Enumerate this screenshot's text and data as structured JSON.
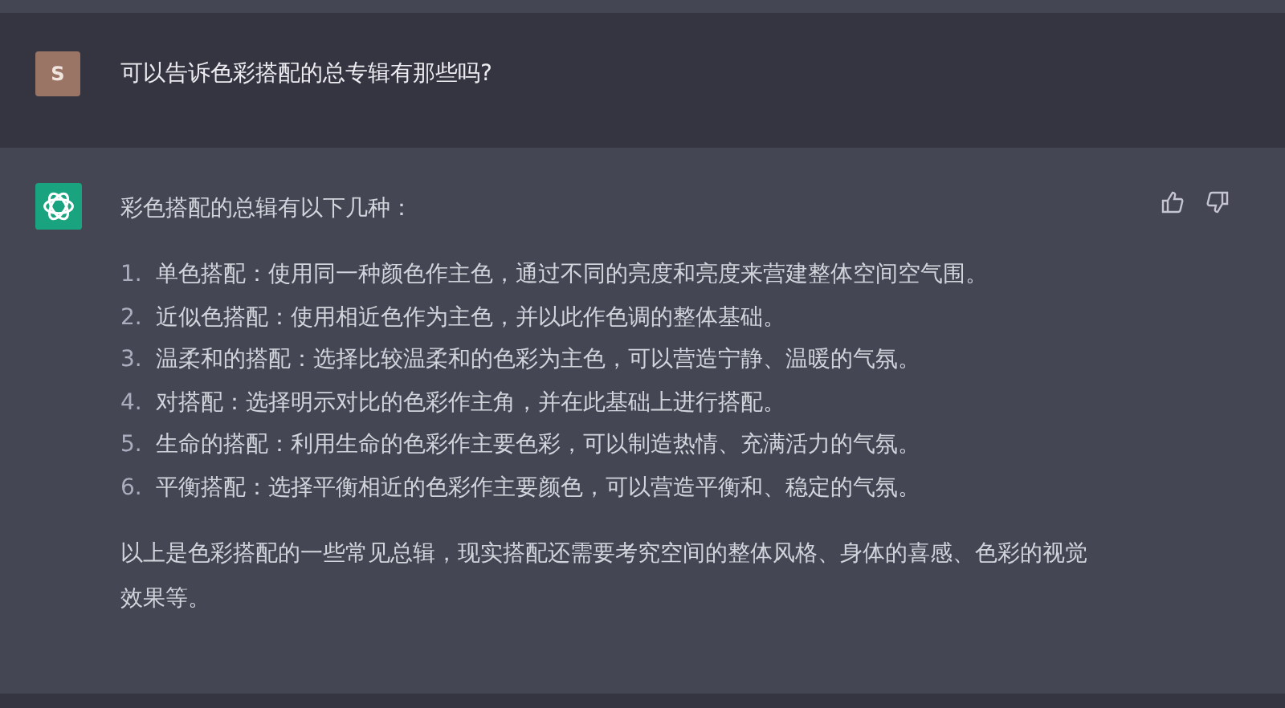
{
  "conversation": [
    {
      "kind": "user",
      "avatar": "S",
      "text": "可以告诉色彩搭配的总专辑有那些吗?"
    },
    {
      "kind": "assistant",
      "intro": "彩色搭配的总辑有以下几种：",
      "items": [
        {
          "number": "1.",
          "text": "单色搭配：使用同一种颜色作主色，通过不同的亮度和亮度来营建整体空间空气围。"
        },
        {
          "number": "2.",
          "text": "近似色搭配：使用相近色作为主色，并以此作色调的整体基础。"
        },
        {
          "number": "3.",
          "text": "温柔和的搭配：选择比较温柔和的色彩为主色，可以营造宁静、温暖的气氛。"
        },
        {
          "number": "4.",
          "text": "对搭配：选择明示对比的色彩作主角，并在此基础上进行搭配。"
        },
        {
          "number": "5.",
          "text": "生命的搭配：利用生命的色彩作主要色彩，可以制造热情、充满活力的气氛。"
        },
        {
          "number": "6.",
          "text": "平衡搭配：选择平衡相近的色彩作主要颜色，可以营造平衡和、稳定的气氛。"
        }
      ],
      "outro": "以上是色彩搭配的一些常见总辑，现实搭配还需要考究空间的整体风格、身体的喜感、色彩的视觉效果等。"
    }
  ]
}
